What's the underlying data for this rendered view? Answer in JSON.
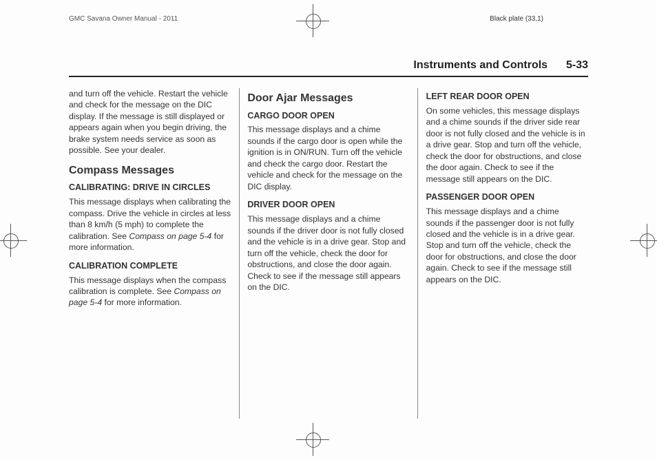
{
  "meta": {
    "manual": "GMC Savana Owner Manual - 2011",
    "plate": "Black plate (33,1)"
  },
  "header": {
    "chapter": "Instruments and Controls",
    "page": "5-33"
  },
  "col1": {
    "cont_para": "and turn off the vehicle. Restart the vehicle and check for the message on the DIC display. If the message is still displayed or appears again when you begin driving, the brake system needs service as soon as possible. See your dealer.",
    "h2_compass": "Compass Messages",
    "h3_calibrating": "CALIBRATING: DRIVE IN CIRCLES",
    "p_calibrating_a": "This message displays when calibrating the compass. Drive the vehicle in circles at less than 8 km/h (5 mph) to complete the calibration. See ",
    "p_calibrating_ref": "Compass on page 5-4",
    "p_calibrating_b": " for more information.",
    "h3_cal_complete": "CALIBRATION COMPLETE",
    "p_cal_complete_a": "This message displays when the compass calibration is complete. See ",
    "p_cal_complete_ref": "Compass on page 5-4",
    "p_cal_complete_b": " for more information."
  },
  "col2": {
    "h2_door": "Door Ajar Messages",
    "h3_cargo": "CARGO DOOR OPEN",
    "p_cargo": "This message displays and a chime sounds if the cargo door is open while the ignition is in ON/RUN. Turn off the vehicle and check the cargo door. Restart the vehicle and check for the message on the DIC display.",
    "h3_driver": "DRIVER DOOR OPEN",
    "p_driver": "This message displays and a chime sounds if the driver door is not fully closed and the vehicle is in a drive gear. Stop and turn off the vehicle, check the door for obstructions, and close the door again. Check to see if the message still appears on the DIC."
  },
  "col3": {
    "h3_leftrear": "LEFT REAR DOOR OPEN",
    "p_leftrear": "On some vehicles, this message displays and a chime sounds if the driver side rear door is not fully closed and the vehicle is in a drive gear. Stop and turn off the vehicle, check the door for obstructions, and close the door again. Check to see if the message still appears on the DIC.",
    "h3_passenger": "PASSENGER DOOR OPEN",
    "p_passenger": "This message displays and a chime sounds if the passenger door is not fully closed and the vehicle is in a drive gear. Stop and turn off the vehicle, check the door for obstructions, and close the door again. Check to see if the message still appears on the DIC."
  }
}
